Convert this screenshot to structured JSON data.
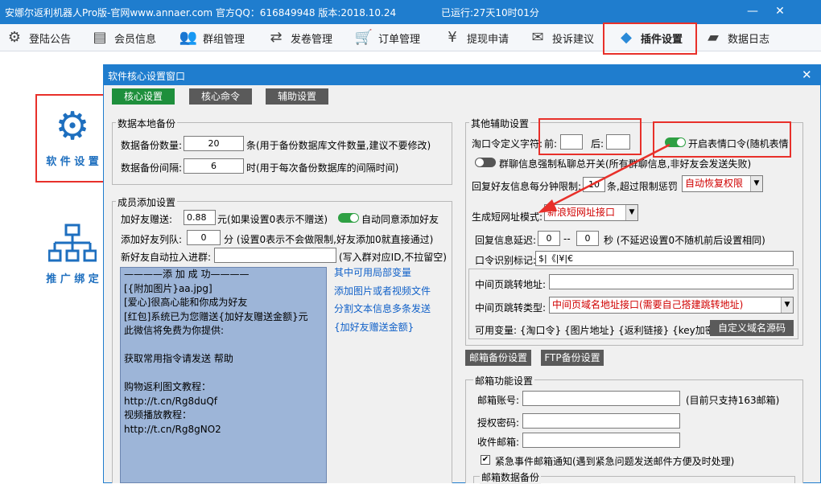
{
  "titlebar": {
    "title": "安娜尔返利机器人Pro版-官网www.annaer.com 官方QQ：616849948 版本:2018.10.24",
    "uptime": "已运行:27天10时01分",
    "min": "—",
    "close": "✕"
  },
  "menu": [
    {
      "label": "登陆公告",
      "icon": "gear-icon"
    },
    {
      "label": "会员信息",
      "icon": "id-card-icon"
    },
    {
      "label": "群组管理",
      "icon": "users-icon"
    },
    {
      "label": "发卷管理",
      "icon": "exchange-icon"
    },
    {
      "label": "订单管理",
      "icon": "cart-icon"
    },
    {
      "label": "提现申请",
      "icon": "yen-icon"
    },
    {
      "label": "投诉建议",
      "icon": "mail-icon"
    },
    {
      "label": "插件设置",
      "icon": "cube-icon"
    },
    {
      "label": "数据日志",
      "icon": "folder-icon"
    }
  ],
  "sidebar": {
    "software_settings": "软 件 设 置",
    "promo_binding": "推 广 绑 定"
  },
  "dialog": {
    "title": "软件核心设置窗口",
    "close": "✕",
    "tabs": [
      "核心设置",
      "核心命令",
      "辅助设置"
    ]
  },
  "backup": {
    "legend": "数据本地备份",
    "count_label": "数据备份数量:",
    "count_value": "20",
    "count_hint": "条(用于备份数据库文件数量,建议不要修改)",
    "interval_label": "数据备份间隔:",
    "interval_value": "6",
    "interval_hint": "时(用于每次备份数据库的间隔时间)"
  },
  "member": {
    "legend": "成员添加设置",
    "gift_label": "加好友赠送:",
    "gift_value": "0.88",
    "gift_hint": "元(如果设置0表示不赠送)",
    "auto_accept": "自动同意添加好友",
    "queue_label": "添加好友列队:",
    "queue_value": "0",
    "queue_hint": "分 (设置0表示不会做限制,好友添加0就直接通过)",
    "group_label": "新好友自动拉入进群:",
    "group_value": "",
    "group_hint": "(写入群对应ID,不拉留空)",
    "message_lines": [
      "————添 加 成 功————",
      "[{附加图片}aa.jpg]",
      "[爱心]很高心能和你成为好友",
      "[红包]系统已为您赠送{加好友赠送金额}元",
      "此微信将免费为你提供:",
      "",
      "获取常用指令请发送  帮助",
      "",
      "购物返利图文教程：",
      "http://t.cn/Rg8duQf",
      "视频播放教程：",
      "http://t.cn/Rg8gNO2"
    ],
    "links": [
      "其中可用局部变量",
      "添加图片或者视频文件",
      "分割文本信息多条发送",
      "{加好友赠送金额}"
    ]
  },
  "other": {
    "legend": "其他辅助设置",
    "kouling_label": "淘口令定义字符:",
    "prefix_label": "前:",
    "prefix_value": "",
    "suffix_label": "后:",
    "suffix_value": "",
    "emoji_toggle": "开启表情口令(随机表情",
    "private_toggle": "群聊信息强制私聊总开关(所有群聊信息,非好友会发送失败)",
    "reply_limit_label": "回复好友信息每分钟限制:",
    "reply_limit_value": "10",
    "reply_limit_hint": "条,超过限制惩罚",
    "penalty_value": "自动恢复权限",
    "short_mode_label": "生成短网址模式:",
    "short_mode_value": "新浪短网址接口",
    "delay_label": "回复信息延迟:",
    "delay_from": "0",
    "delay_sep": "--",
    "delay_to": "0",
    "delay_hint": "秒 (不延迟设置0不随机前后设置相同)",
    "kouling_id_label": "口令识别标记:",
    "kouling_id_value": "$|《|¥|€",
    "jump_url_label": "中间页跳转地址:",
    "jump_url_value": "",
    "jump_type_label": "中间页跳转类型:",
    "jump_type_value": "中间页域名地址接口(需要自己搭建跳转地址)",
    "vars": "可用变量: {淘口令} {图片地址} {返利链接} {key加密}",
    "custom_domain_btn": "自定义域名源码"
  },
  "mail_buttons": [
    "邮箱备份设置",
    "FTP备份设置"
  ],
  "mail": {
    "legend": "邮箱功能设置",
    "account_label": "邮箱账号:",
    "account_value": "",
    "account_hint": "(目前只支持163邮箱)",
    "auth_label": "授权密码:",
    "auth_value": "",
    "receive_label": "收件邮箱:",
    "receive_value": "",
    "urgent_label": "紧急事件邮箱通知(遇到紧急问题发送邮件方便及时处理)",
    "urgent_checked": "✔",
    "backup_legend": "邮箱数据备份"
  },
  "colors": {
    "titlebar": "#1f7dce",
    "highlight": "#e8302a",
    "tab_active": "#1e8f3c",
    "tab_inactive": "#5a5a5a",
    "toggle_on": "#2ea043",
    "toggle_off": "#555555"
  }
}
